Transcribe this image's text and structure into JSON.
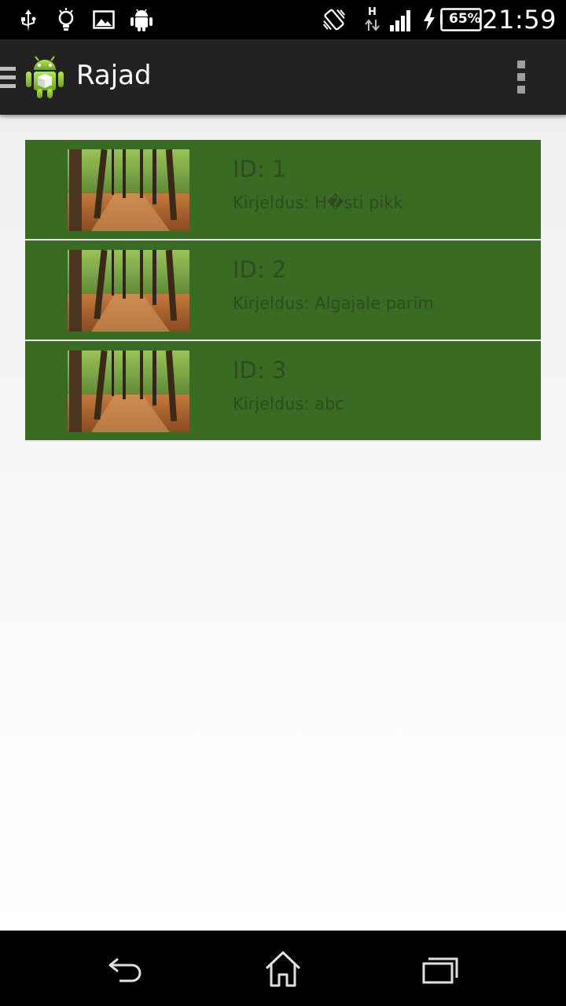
{
  "status_bar": {
    "time": "21:59",
    "battery": "65%",
    "network_type": "H",
    "icons": [
      "usb-icon",
      "lightbulb-icon",
      "image-icon",
      "android-icon",
      "vibrate-icon",
      "data-arrows-icon",
      "signal-icon",
      "charging-icon",
      "battery-icon"
    ]
  },
  "action_bar": {
    "title": "Rajad",
    "icons": [
      "drawer-icon",
      "android-app-icon",
      "overflow-menu-icon"
    ]
  },
  "trails": [
    {
      "id_text": "ID: 1",
      "description": "Kirjeldus: H�sti pikk",
      "image": "forest-path-image"
    },
    {
      "id_text": "ID: 2",
      "description": "Kirjeldus: Algajale parim",
      "image": "forest-path-image"
    },
    {
      "id_text": "ID: 3",
      "description": "Kirjeldus: abc",
      "image": "forest-path-image"
    }
  ],
  "nav_bar": {
    "icons": [
      "back-icon",
      "home-icon",
      "recent-apps-icon"
    ]
  },
  "colors": {
    "list_item_bg": "#3a6b22",
    "list_item_text": "#2f4a24",
    "action_bar_bg": "#222222"
  }
}
